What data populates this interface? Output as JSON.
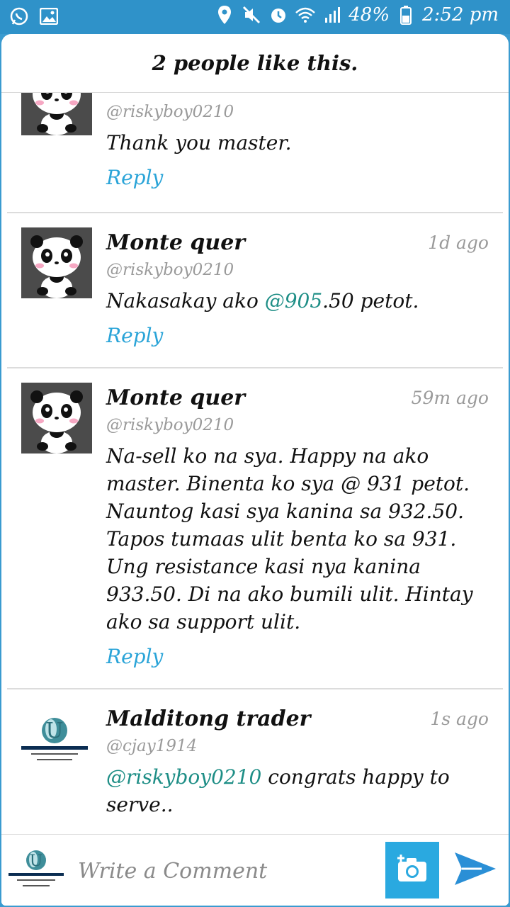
{
  "status_bar": {
    "battery": "48%",
    "time": "2:52 pm"
  },
  "header": {
    "likes_text": "2 people like this."
  },
  "comments": [
    {
      "name": "",
      "handle": "@riskyboy0210",
      "time": "",
      "text": "Thank you master.",
      "reply_label": "Reply"
    },
    {
      "name": "Monte quer",
      "handle": "@riskyboy0210",
      "time": "1d ago",
      "text_before": "Nakasakay ako ",
      "mention": "@905",
      "text_after": ".50 petot.",
      "reply_label": "Reply"
    },
    {
      "name": "Monte quer",
      "handle": "@riskyboy0210",
      "time": "59m ago",
      "text": "Na-sell ko na sya. Happy na ako master. Binenta ko sya @ 931 petot. Nauntog kasi sya kanina sa 932.50. Tapos tumaas ulit benta ko sa 931. Ung resistance kasi nya kanina 933.50. Di na ako bumili ulit. Hintay ako sa support ulit.",
      "reply_label": "Reply"
    },
    {
      "name": "Malditong trader",
      "handle": "@cjay1914",
      "time": "1s ago",
      "mention": "@riskyboy0210",
      "text_after": " congrats happy to serve.."
    }
  ],
  "composer": {
    "placeholder": "Write a Comment"
  },
  "colors": {
    "status_bar": "#2f92c9",
    "accent": "#2aa9e0",
    "mention": "#1e8e86",
    "send": "#2a8fd6"
  }
}
